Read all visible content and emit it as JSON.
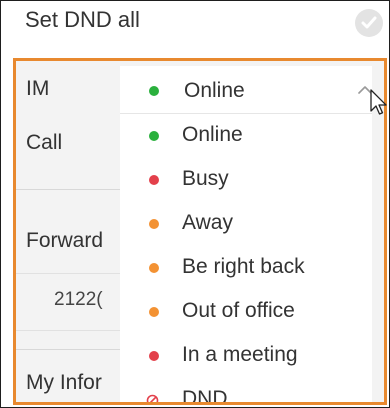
{
  "header": {
    "dnd_label": "Set DND all"
  },
  "settings": {
    "im_label": "IM",
    "call_label": "Call",
    "forward_label": "Forward",
    "forward_number": "2122(",
    "my_info_label": "My Infor"
  },
  "im_status": {
    "selected": "Online",
    "options": [
      {
        "label": "Online",
        "color": "#2ab03d"
      },
      {
        "label": "Busy",
        "color": "#e3404b"
      },
      {
        "label": "Away",
        "color": "#f39233"
      },
      {
        "label": "Be right back",
        "color": "#f39233"
      },
      {
        "label": "Out of office",
        "color": "#f39233"
      },
      {
        "label": "In a meeting",
        "color": "#e3404b"
      },
      {
        "label": "DND",
        "color": "#e3404b",
        "icon": "dnd-icon"
      }
    ]
  },
  "colors": {
    "highlight_border": "#e8892f",
    "online": "#2ab03d"
  }
}
